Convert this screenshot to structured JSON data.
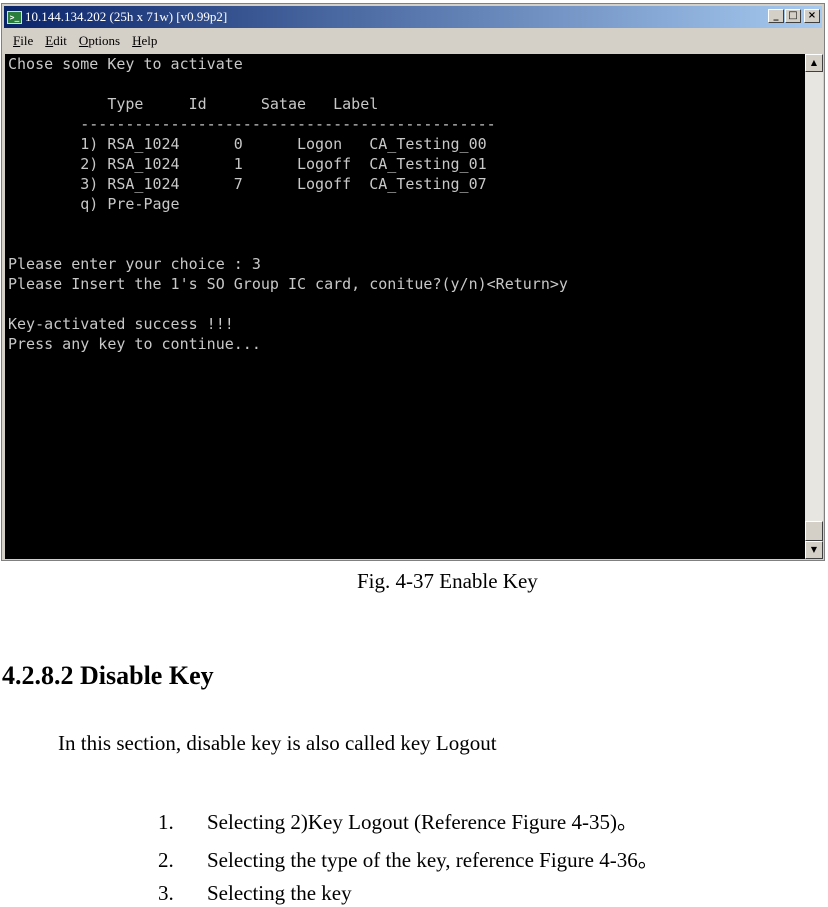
{
  "window": {
    "title": "10.144.134.202 (25h x 71w) [v0.99p2]",
    "icon": "terminal-app-icon",
    "buttons": {
      "minimize": "_",
      "maximize": "□",
      "close": "×"
    },
    "menu": [
      {
        "hot": "F",
        "rest": "ile"
      },
      {
        "hot": "E",
        "rest": "dit"
      },
      {
        "hot": "O",
        "rest": "ptions"
      },
      {
        "hot": "H",
        "rest": "elp"
      }
    ]
  },
  "terminal": {
    "lines": [
      "Chose some Key to activate",
      "",
      "           Type     Id      Satae   Label",
      "        ----------------------------------------------",
      "        1) RSA_1024      0      Logon   CA_Testing_00",
      "        2) RSA_1024      1      Logoff  CA_Testing_01",
      "        3) RSA_1024      7      Logoff  CA_Testing_07",
      "        q) Pre-Page",
      "",
      "",
      "Please enter your choice : 3",
      "Please Insert the 1's SO Group IC card, conitue?(y/n)<Return>y",
      "",
      "Key-activated success !!!",
      "Press any key to continue..."
    ]
  },
  "document": {
    "caption": "Fig. 4-37 Enable Key",
    "heading": "4.2.8.2 Disable Key",
    "paragraph": "In this section, disable key is also called key Logout",
    "steps": [
      {
        "num": "1.",
        "text": "Selecting   2)Key  Logout (Reference Figure 4-35)。"
      },
      {
        "num": "2.",
        "text": "Selecting the type of the key, reference Figure 4-36。"
      },
      {
        "num": "3.",
        "text": "Selecting the key"
      }
    ]
  }
}
